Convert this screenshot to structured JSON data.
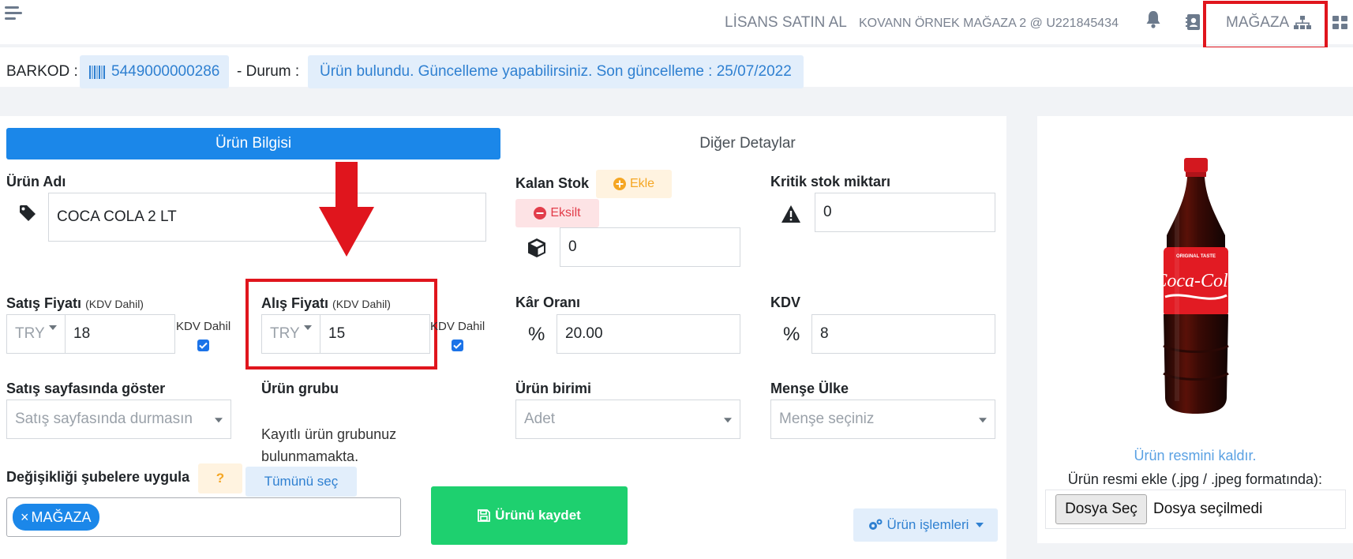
{
  "topbar": {
    "license_link": "LİSANS SATIN AL",
    "store_info": "KOVANN ÖRNEK MAĞAZA 2 @ U221845434",
    "store_button": "MAĞAZA"
  },
  "barcode": {
    "label": "BARKOD :",
    "value": "5449000000286",
    "status_label": "- Durum :",
    "status_text": "Ürün bulundu. Güncelleme yapabilirsiniz. Son güncelleme : 25/07/2022"
  },
  "tabs": [
    {
      "label": "Ürün Bilgisi",
      "active": true
    },
    {
      "label": "Diğer Detaylar",
      "active": false
    }
  ],
  "form": {
    "product_name": {
      "label": "Ürün Adı",
      "value": "COCA COLA 2 LT"
    },
    "stock": {
      "label": "Kalan Stok",
      "add_label": "Ekle",
      "remove_label": "Eksilt",
      "value": "0"
    },
    "critical_stock": {
      "label": "Kritik stok miktarı",
      "value": "0"
    },
    "sale_price": {
      "label": "Satış Fiyatı",
      "note": "(KDV Dahil)",
      "currency": "TRY",
      "value": "18",
      "vat_included_label": "KDV Dahil",
      "vat_included": true
    },
    "purchase_price": {
      "label": "Alış Fiyatı",
      "note": "(KDV Dahil)",
      "currency": "TRY",
      "value": "15",
      "vat_included_label": "KDV Dahil",
      "vat_included": true
    },
    "profit_rate": {
      "label": "Kâr Oranı",
      "symbol": "%",
      "value": "20.00"
    },
    "vat": {
      "label": "KDV",
      "symbol": "%",
      "value": "8"
    },
    "show_on_sales": {
      "label": "Satış sayfasında göster",
      "selected": "Satış sayfasında durmasın"
    },
    "product_group": {
      "label": "Ürün grubu",
      "text": "Kayıtlı ürün grubunuz bulunmamakta."
    },
    "unit": {
      "label": "Ürün birimi",
      "selected": "Adet"
    },
    "origin": {
      "label": "Menşe Ülke",
      "placeholder": "Menşe seçiniz"
    },
    "branches": {
      "label": "Değişikliği şubelere uygula",
      "help": "?",
      "select_all": "Tümünü seç",
      "chip": "MAĞAZA"
    },
    "save_button": "Ürünü kaydet",
    "actions_button": "Ürün işlemleri"
  },
  "image_panel": {
    "remove_link": "Ürün resmini kaldır.",
    "add_label": "Ürün resmi ekle (.jpg / .jpeg formatında):",
    "file_button": "Dosya Seç",
    "file_status": "Dosya seçilmedi",
    "bottle_label_top": "ORIGINAL TASTE",
    "bottle_brand": "Coca-Cola"
  },
  "colors": {
    "primary": "#1b87e9",
    "success": "#1ed06f",
    "annotation_red": "#e0151d"
  }
}
